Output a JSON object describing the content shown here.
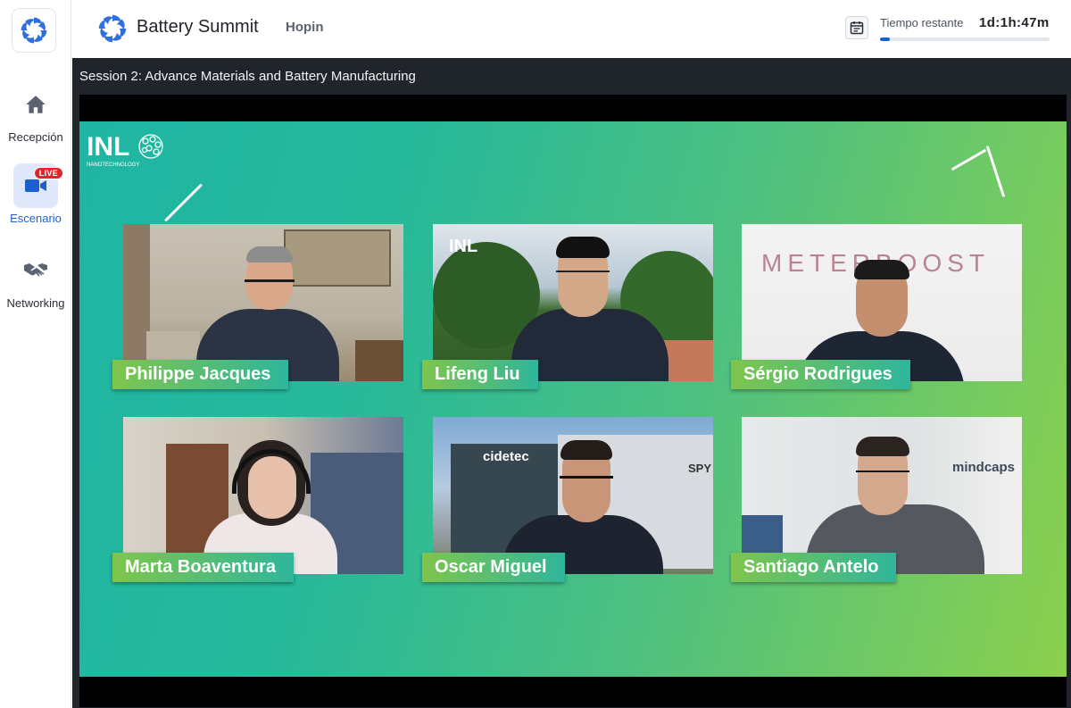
{
  "sidebar": {
    "logo": "hopin-swirl-logo",
    "items": [
      {
        "label": "Recepción",
        "icon": "home-icon",
        "active": false
      },
      {
        "label": "Escenario",
        "icon": "video-camera-icon",
        "active": true,
        "badge": "LIVE"
      },
      {
        "label": "Networking",
        "icon": "handshake-icon",
        "active": false
      }
    ]
  },
  "header": {
    "event_title": "Battery Summit",
    "org_name": "Hopin",
    "calendar_icon": "calendar-icon",
    "time_label": "Tiempo restante",
    "time_value": "1d:1h:47m",
    "time_progress": 0.06
  },
  "stage": {
    "session_title": "Session 2: Advance Materials and Battery Manufacturing",
    "logo_text": "INL",
    "logo_subtext": "NANOTECHNOLOGY",
    "speakers": [
      {
        "name": "Philippe Jacques"
      },
      {
        "name": "Lifeng Liu",
        "overlay_text": "INL"
      },
      {
        "name": "Sérgio Rodrigues",
        "overlay_text": "METERBOOST"
      },
      {
        "name": "Marta Boaventura"
      },
      {
        "name": "Oscar Miguel",
        "overlay_text": "cidetec",
        "overlay_text_2": "SPY"
      },
      {
        "name": "Santiago Antelo",
        "overlay_text": "mindcaps"
      }
    ]
  },
  "colors": {
    "accent": "#1d5fd1",
    "live": "#e0262c",
    "stage_bg": "#20242b",
    "gradient_start": "#1fb5a4",
    "gradient_end": "#8cd04d"
  }
}
